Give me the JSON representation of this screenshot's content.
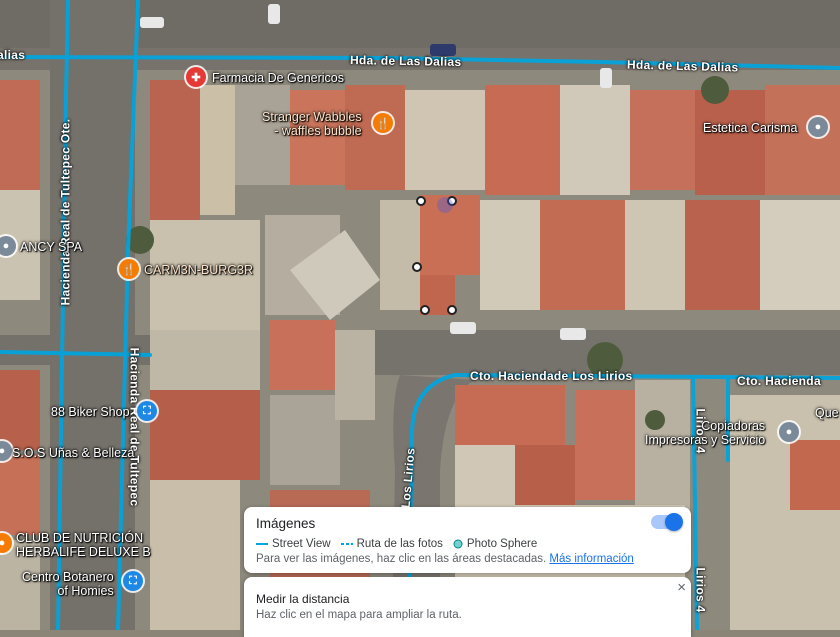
{
  "streets": {
    "dalias_left": "Hda. de Las Dalias",
    "dalias_right": "Hda. de Las Dalias",
    "dalias_edge": "alias",
    "lirios_main": "Cto. Haciendade Los Lirios",
    "lirios_right": "Cto. Hacienda",
    "tultepec_ote": "Hacienda Real de Tultepec Ote.",
    "tultepec_mid": "Hacienda Real de Tultepec",
    "de_los_lirios": "de Los Lirios",
    "lirios_4_top": "Lirios 4",
    "lirios_4_bottom": "Lirios 4"
  },
  "places": [
    {
      "label": "Farmacia De Genericos",
      "icon": "pharmacy-icon",
      "color": "#e53935"
    },
    {
      "label": "Stranger Wabbles\n- waffles bubble",
      "icon": "restaurant-icon",
      "color": "#f57c00"
    },
    {
      "label": "Estetica Carisma",
      "icon": "place-icon",
      "color": "#7b8a99"
    },
    {
      "label": "ANCY SPA",
      "icon": "place-icon",
      "color": "#7b8a99"
    },
    {
      "label": "CARM3N-BURG3R",
      "icon": "restaurant-icon",
      "color": "#f57c00"
    },
    {
      "label": "88 Biker Shop",
      "icon": "shopping-icon",
      "color": "#1e88e5"
    },
    {
      "label": "S.O.S Uñas & Belleza",
      "icon": "place-icon",
      "color": "#7b8a99"
    },
    {
      "label": "Copiadoras\nImpresoras y Servicio",
      "icon": "place-icon",
      "color": "#7b8a99"
    },
    {
      "label": "CLUB DE NUTRICIÓN\nHERBALIFE DELUXE B",
      "icon": "place-icon",
      "color": "#f57c00"
    },
    {
      "label": "Centro Botanero\nof Homies",
      "icon": "shopping-icon",
      "color": "#1e88e5"
    },
    {
      "label": "Que",
      "icon": "place-icon",
      "color": "#7b8a99"
    }
  ],
  "images_panel": {
    "title": "Imágenes",
    "legend_street_view": "Street View",
    "legend_ruta": "Ruta de las fotos",
    "legend_sphere": "Photo Sphere",
    "hint": "Para ver las imágenes, haz clic en las áreas destacadas.",
    "link": "Más información",
    "toggle_on": true,
    "accent": "#1a73e8",
    "line_color": "#00a5e0"
  },
  "distance_panel": {
    "title": "Medir la distancia",
    "hint": "Haz clic en el mapa para ampliar la ruta.",
    "close": "×"
  }
}
